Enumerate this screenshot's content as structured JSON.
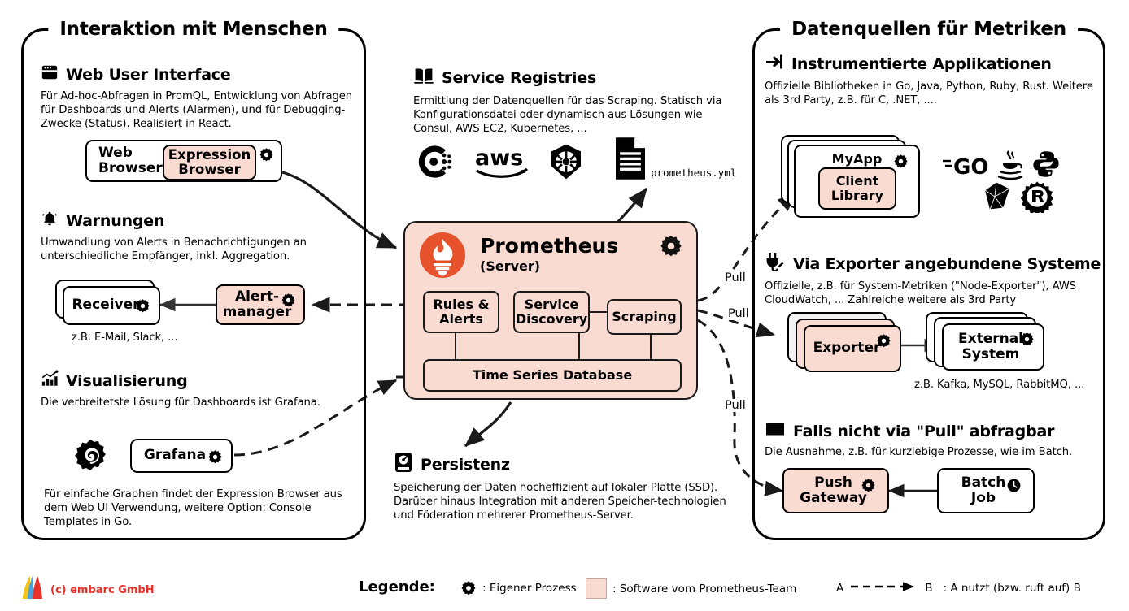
{
  "diagram": {
    "title": "Prometheus Architecture (German)",
    "colors": {
      "pink": "#FADBD2",
      "prometheus_orange": "#E6522C",
      "brand_red": "#e8312a",
      "line": "#000000"
    }
  },
  "left_panel": {
    "title": "Interaktion mit Menschen",
    "sections": [
      {
        "id": "web-ui",
        "icon": "browser-window-icon",
        "heading": "Web User Interface",
        "desc": "Für Ad-hoc-Abfragen in PromQL, Entwicklung von Abfragen für Dashboards und Alerts (Alarmen), und für Debugging-Zwecke (Status). Realisiert in React.",
        "nodes": {
          "outer": "Web\nBrowser",
          "outer_line1": "Web",
          "outer_line2": "Browser",
          "inner": "Expression\nBrowser",
          "inner_line1": "Expression",
          "inner_line2": "Browser"
        }
      },
      {
        "id": "warnungen",
        "icon": "bell-icon",
        "heading": "Warnungen",
        "desc": "Umwandlung von Alerts in Benachrichtigungen an unterschiedliche Empfänger, inkl. Aggregation.",
        "nodes": {
          "receiver": "Receiver",
          "alertmanager_line1": "Alert-",
          "alertmanager_line2": "manager"
        },
        "note": "z.B. E-Mail, Slack, ..."
      },
      {
        "id": "visualisierung",
        "icon": "bar-chart-icon",
        "heading": "Visualisierung",
        "desc": "Die verbreitetste Lösung für Dashboards ist Grafana.",
        "nodes": {
          "grafana": "Grafana"
        },
        "note": "Für einfache Graphen findet der Expression Browser aus dem Web UI Verwendung, weitere Option: Console Templates in Go."
      }
    ]
  },
  "center": {
    "service_registries": {
      "icon": "open-book-icon",
      "heading": "Service Registries",
      "desc": "Ermittlung der Datenquellen für das Scraping. Statisch via Konfigurationsdatei oder dynamisch aus Lösungen wie Consul, AWS EC2, Kubernetes, ...",
      "logos": [
        "consul-logo",
        "aws-logo",
        "kubernetes-logo",
        "document-file-icon"
      ],
      "file_label": "prometheus.yml"
    },
    "server": {
      "logo": "prometheus-flame-logo",
      "title": "Prometheus",
      "subtitle": "(Server)",
      "gear": "gear-icon",
      "components": [
        {
          "id": "rules-alerts",
          "line1": "Rules &",
          "line2": "Alerts"
        },
        {
          "id": "service-discovery",
          "line1": "Service",
          "line2": "Discovery"
        },
        {
          "id": "scraping",
          "line1": "Scraping",
          "line2": ""
        },
        {
          "id": "tsdb",
          "line1": "Time Series Database",
          "line2": ""
        }
      ]
    },
    "persistenz": {
      "icon": "hard-disk-icon",
      "heading": "Persistenz",
      "desc": "Speicherung der Daten hocheffizient auf lokaler Platte (SSD). Darüber hinaus Integration mit anderen Speicher-technologien und Föderation mehrerer Prometheus-Server."
    }
  },
  "right_panel": {
    "title": "Datenquellen für Metriken",
    "sections": [
      {
        "id": "instrumented-apps",
        "icon": "login-arrow-icon",
        "heading": "Instrumentierte Applikationen",
        "desc": "Offizielle Bibliotheken in Go, Java, Python, Ruby, Rust. Weitere als 3rd Party, z.B. für C, .NET, ....",
        "nodes": {
          "myapp": "MyApp",
          "client_library_line1": "Client",
          "client_library_line2": "Library"
        },
        "logos": [
          "go-logo",
          "java-logo",
          "python-logo",
          "ruby-logo",
          "rust-logo"
        ]
      },
      {
        "id": "exporter",
        "icon": "power-plug-icon",
        "heading": "Via Exporter angebundene Systeme",
        "desc": "Offizielle, z.B. für System-Metriken (\"Node-Exporter\"), AWS CloudWatch, ... Zahlreiche weitere als 3rd Party",
        "nodes": {
          "exporter": "Exporter",
          "external_line1": "External",
          "external_line2": "System"
        },
        "note": "z.B. Kafka, MySQL, RabbitMQ, ..."
      },
      {
        "id": "push",
        "icon": "inbox-icon",
        "heading": "Falls nicht via \"Pull\" abfragbar",
        "desc": "Die Ausnahme, z.B. für kurzlebige Prozesse, wie im Batch.",
        "nodes": {
          "push_line1": "Push",
          "push_line2": "Gateway",
          "batch_line1": "Batch",
          "batch_line2": "Job"
        }
      }
    ]
  },
  "edge_labels": {
    "pull1": "Pull",
    "pull2": "Pull",
    "pull3": "Pull"
  },
  "legend": {
    "title": "Legende:",
    "items": [
      {
        "icon": "gear-icon",
        "text": ": Eigener Prozess"
      },
      {
        "icon": "pink-swatch",
        "text": ": Software vom Prometheus-Team"
      },
      {
        "icon": "dashed-arrow",
        "prefix": "A",
        "suffix": "B",
        "text": ": A nutzt (bzw. ruft auf) B"
      }
    ]
  },
  "footer": {
    "brand": "(c) embarc GmbH",
    "logo": "embarc-sail-logo"
  }
}
